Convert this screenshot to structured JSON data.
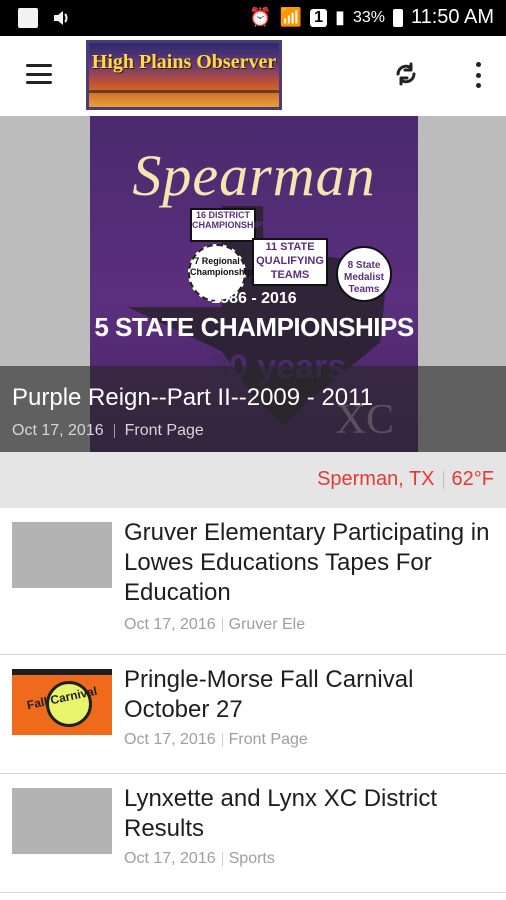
{
  "status_bar": {
    "sim_label": "1",
    "battery": "33%",
    "time": "11:50 AM"
  },
  "app_bar": {
    "logo_text": "High Plains Observer"
  },
  "hero": {
    "poster": {
      "title": "Spearman",
      "badge_district": "16 DISTRICT CHAMPIONSHIPS",
      "badge_regional": "7 Regional Championships",
      "badge_state_qualifying": "11 STATE QUALIFYING TEAMS",
      "badge_medalist": "8 State Medalist Teams",
      "years": "1986 - 2016",
      "championships": "5 STATE CHAMPIONSHIPS",
      "thirty": "30 years",
      "xc": "XC"
    },
    "title": "Purple Reign--Part II--2009 - 2011",
    "date": "Oct 17, 2016",
    "category": "Front Page"
  },
  "weather": {
    "location": "Sperman, TX",
    "temperature": "62°F"
  },
  "articles": [
    {
      "title": "Gruver Elementary Participating in Lowes Educations Tapes For Education",
      "date": "Oct 17, 2016",
      "category": "Gruver Ele",
      "thumb_text": ""
    },
    {
      "title": "Pringle-Morse Fall Carnival October 27",
      "date": "Oct 17, 2016",
      "category": "Front Page",
      "thumb_text": "Fall Carnival"
    },
    {
      "title": "Lynxette and Lynx XC District Results",
      "date": "Oct 17, 2016",
      "category": "Sports",
      "thumb_text": ""
    }
  ],
  "colors": {
    "status_bar": "#000000",
    "weather_accent": "#e53935",
    "list_divider": "#d7d7d7"
  }
}
